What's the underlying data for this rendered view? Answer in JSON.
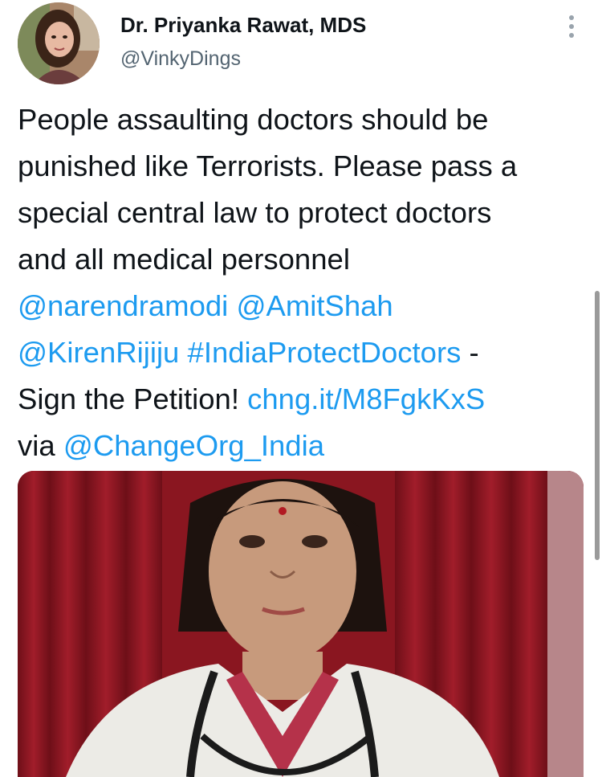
{
  "tweet": {
    "author_name": "Dr. Priyanka Rawat, MDS",
    "author_handle": "@VinkyDings",
    "text": {
      "line1": "People assaulting doctors should be",
      "line2": "punished like Terrorists. Please pass a",
      "line3": "special central law to protect doctors",
      "line4": "and all medical personnel",
      "mention1": "@narendramodi",
      "mention2": "@AmitShah",
      "mention3": "@KirenRijiju",
      "hashtag": "#IndiaProtectDoctors",
      "dash": " -",
      "sign_prefix": "Sign the Petition! ",
      "short_link": "chng.it/M8FgkKxS",
      "via_prefix": "via ",
      "mention4": "@ChangeOrg_India"
    }
  },
  "icons": {
    "more": "more-vertical-icon"
  },
  "colors": {
    "link": "#1d9bf0",
    "text": "#0f1419",
    "secondary": "#536471"
  }
}
